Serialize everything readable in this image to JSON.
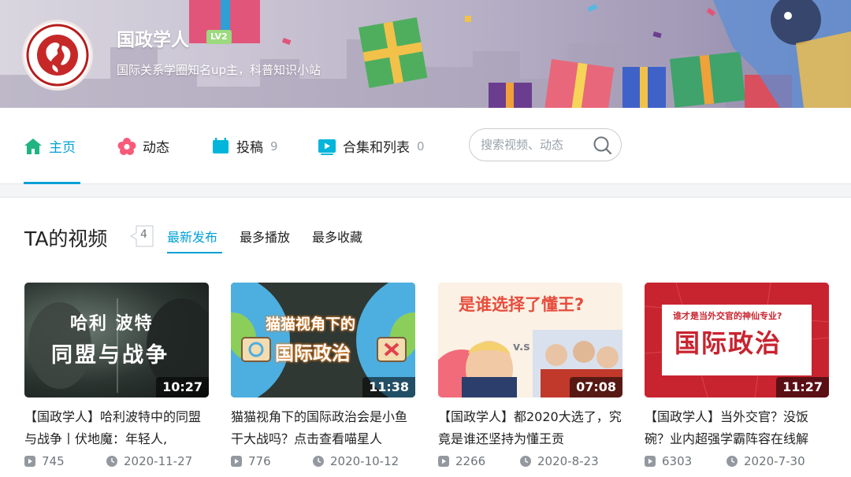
{
  "profile": {
    "name": "国政学人",
    "level": "LV2",
    "sign": "国际关系学圈知名up主，科普知识小站"
  },
  "nav": {
    "tabs": [
      {
        "label": "主页",
        "count": "",
        "icon": "home-icon",
        "active": true
      },
      {
        "label": "动态",
        "count": "",
        "icon": "dynamic-icon",
        "active": false
      },
      {
        "label": "投稿",
        "count": "9",
        "icon": "upload-icon",
        "active": false
      },
      {
        "label": "合集和列表",
        "count": "0",
        "icon": "collection-icon",
        "active": false
      }
    ],
    "search_placeholder": "搜索视频、动态"
  },
  "videos_section": {
    "title": "TA的视频",
    "count": "4",
    "sort_options": [
      "最新发布",
      "最多播放",
      "最多收藏"
    ],
    "active_sort": "最新发布"
  },
  "videos": [
    {
      "thumb_text_1": "哈利 波特",
      "thumb_text_2": "同盟与战争",
      "duration": "10:27",
      "title": "【国政学人】哈利波特中的同盟与战争丨伏地魔：年轻人,",
      "plays": "745",
      "date": "2020-11-27"
    },
    {
      "thumb_text_1": "猫猫视角下的",
      "thumb_text_2": "国际政治",
      "duration": "11:38",
      "title": "猫猫视角下的国际政治会是小鱼干大战吗？点击查看喵星人",
      "plays": "776",
      "date": "2020-10-12"
    },
    {
      "thumb_text_1": "是谁选择了懂王?",
      "thumb_text_2": "v.s",
      "duration": "07:08",
      "title": "【国政学人】都2020大选了，究竟是谁还坚持为懂王贡",
      "plays": "2266",
      "date": "2020-8-23"
    },
    {
      "thumb_text_1": "谁才是当外交官的神仙专业?",
      "thumb_text_2": "国际政治",
      "duration": "11:27",
      "title": "【国政学人】当外交官？没饭碗？业内超强学霸阵容在线解",
      "plays": "6303",
      "date": "2020-7-30"
    }
  ],
  "colors": {
    "accent": "#00a1d6",
    "level_badge": "#9cd97f"
  }
}
